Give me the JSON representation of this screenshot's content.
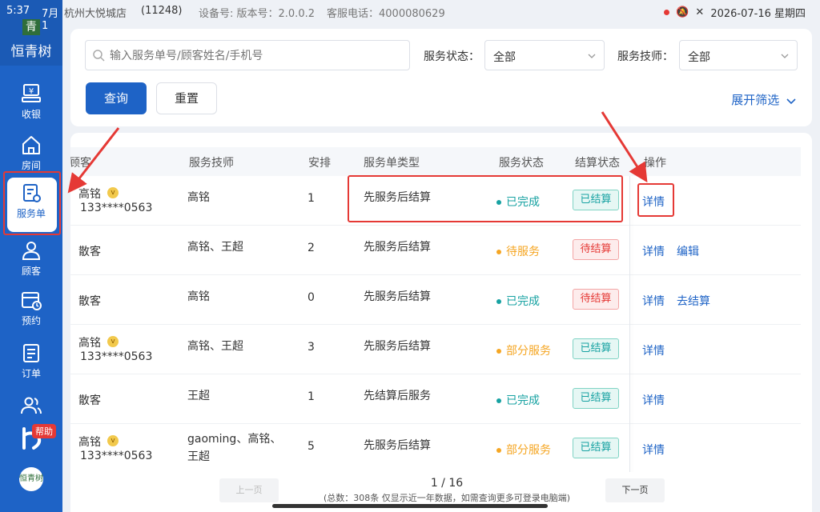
{
  "status_bar": {
    "time": "5:37",
    "date": "7月1",
    "store_name": "杭州大悦城店",
    "store_id": "(11248)",
    "device_info": "设备号: 版本号：2.0.0.2",
    "service_phone": "客服电话：4000080629",
    "system_date": "2026-07-16 星期四"
  },
  "brand": {
    "mark": "青",
    "name": "恒青树",
    "small_logo": "恒青树"
  },
  "sidebar": {
    "items": [
      {
        "label": "收银",
        "icon": "cashier-icon"
      },
      {
        "label": "房间",
        "icon": "home-icon"
      },
      {
        "label": "服务单",
        "icon": "service-order-icon",
        "active": true
      },
      {
        "label": "顾客",
        "icon": "customer-icon"
      },
      {
        "label": "预约",
        "icon": "calendar-clock-icon"
      },
      {
        "label": "订单",
        "icon": "order-icon"
      },
      {
        "label": "",
        "icon": "staff-icon"
      }
    ],
    "help_label": "帮助"
  },
  "filter": {
    "search_placeholder": "输入服务单号/顾客姓名/手机号",
    "status_label": "服务状态：",
    "status_value": "全部",
    "tech_label": "服务技师：",
    "tech_value": "全部",
    "query_button": "查询",
    "reset_button": "重置",
    "expand_label": "展开筛选"
  },
  "table": {
    "headers": [
      "顾客",
      "服务技师",
      "安排",
      "服务单类型",
      "服务状态",
      "结算状态",
      "操作"
    ],
    "rows": [
      {
        "customer": "高铭",
        "vip": true,
        "phone": "133****0563",
        "tech": "高铭",
        "count": "1",
        "type": "先服务后结算",
        "status": "已完成",
        "status_color": "#17a2a2",
        "settle": "已结算",
        "settle_kind": "green",
        "ops": [
          "详情"
        ]
      },
      {
        "customer": "散客",
        "vip": false,
        "phone": "",
        "tech": "高铭、王超",
        "count": "2",
        "type": "先服务后结算",
        "status": "待服务",
        "status_color": "#f5a623",
        "settle": "待结算",
        "settle_kind": "red",
        "ops": [
          "详情",
          "编辑"
        ]
      },
      {
        "customer": "散客",
        "vip": false,
        "phone": "",
        "tech": "高铭",
        "count": "0",
        "type": "先服务后结算",
        "status": "已完成",
        "status_color": "#17a2a2",
        "settle": "待结算",
        "settle_kind": "red",
        "ops": [
          "详情",
          "去结算"
        ]
      },
      {
        "customer": "高铭",
        "vip": true,
        "phone": "133****0563",
        "tech": "高铭、王超",
        "count": "3",
        "type": "先服务后结算",
        "status": "部分服务",
        "status_color": "#f5a623",
        "settle": "已结算",
        "settle_kind": "green",
        "ops": [
          "详情"
        ]
      },
      {
        "customer": "散客",
        "vip": false,
        "phone": "",
        "tech": "王超",
        "count": "1",
        "type": "先结算后服务",
        "status": "已完成",
        "status_color": "#17a2a2",
        "settle": "已结算",
        "settle_kind": "green",
        "ops": [
          "详情"
        ]
      },
      {
        "customer": "高铭",
        "vip": true,
        "phone": "133****0563",
        "tech": "gaoming、高铭、王超",
        "count": "5",
        "type": "先服务后结算",
        "status": "部分服务",
        "status_color": "#f5a623",
        "settle": "已结算",
        "settle_kind": "green",
        "ops": [
          "详情"
        ]
      }
    ]
  },
  "pagination": {
    "prev": "上一页",
    "next": "下一页",
    "page": "1 / 16",
    "summary": "(总数：308条 仅显示近一年数据，如需查询更多可登录电脑端)"
  },
  "colors": {
    "primary": "#1e63c6",
    "annotation": "#e53935"
  }
}
